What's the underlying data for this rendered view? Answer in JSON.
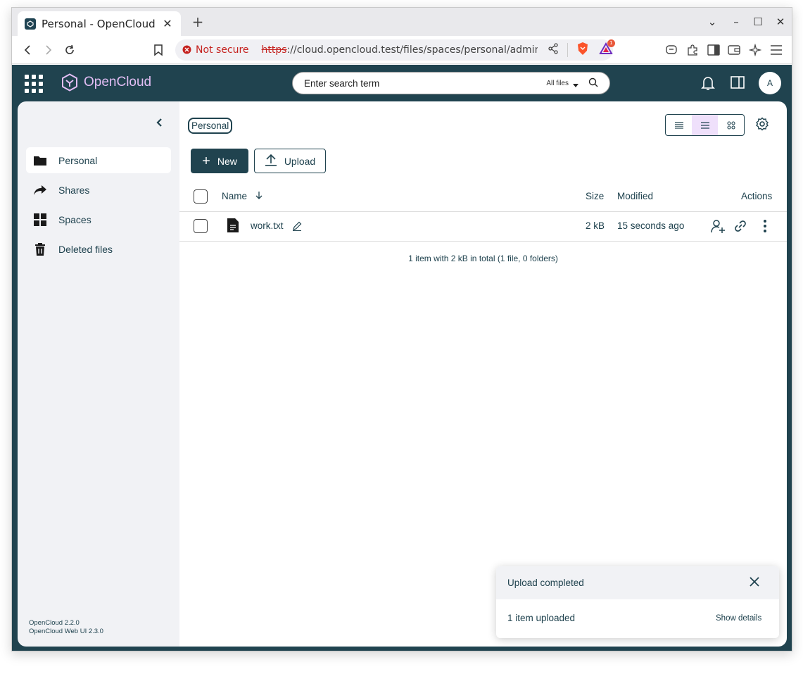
{
  "browser": {
    "tab_title": "Personal - OpenCloud",
    "security_label": "Not secure",
    "url_protocol": "https",
    "url_rest": "://cloud.opencloud.test/files/spaces/personal/admin?fil...",
    "shield_badge": "1"
  },
  "header": {
    "brand": "OpenCloud",
    "search_placeholder": "Enter search term",
    "search_scope": "All files",
    "avatar_initial": "A"
  },
  "sidebar": {
    "items": [
      {
        "label": "Personal",
        "icon": "folder-icon"
      },
      {
        "label": "Shares",
        "icon": "share-icon"
      },
      {
        "label": "Spaces",
        "icon": "grid-icon"
      },
      {
        "label": "Deleted files",
        "icon": "trash-icon"
      }
    ],
    "version_core": "OpenCloud 2.2.0",
    "version_web": "OpenCloud Web UI 2.3.0"
  },
  "main": {
    "breadcrumb": "Personal",
    "new_label": "New",
    "upload_label": "Upload",
    "columns": {
      "name": "Name",
      "size": "Size",
      "modified": "Modified",
      "actions": "Actions"
    },
    "files": [
      {
        "name": "work.txt",
        "size": "2 kB",
        "modified": "15 seconds ago"
      }
    ],
    "summary": "1 item with 2 kB in total (1 file, 0 folders)"
  },
  "toast": {
    "title": "Upload completed",
    "message": "1 item uploaded",
    "link": "Show details"
  }
}
